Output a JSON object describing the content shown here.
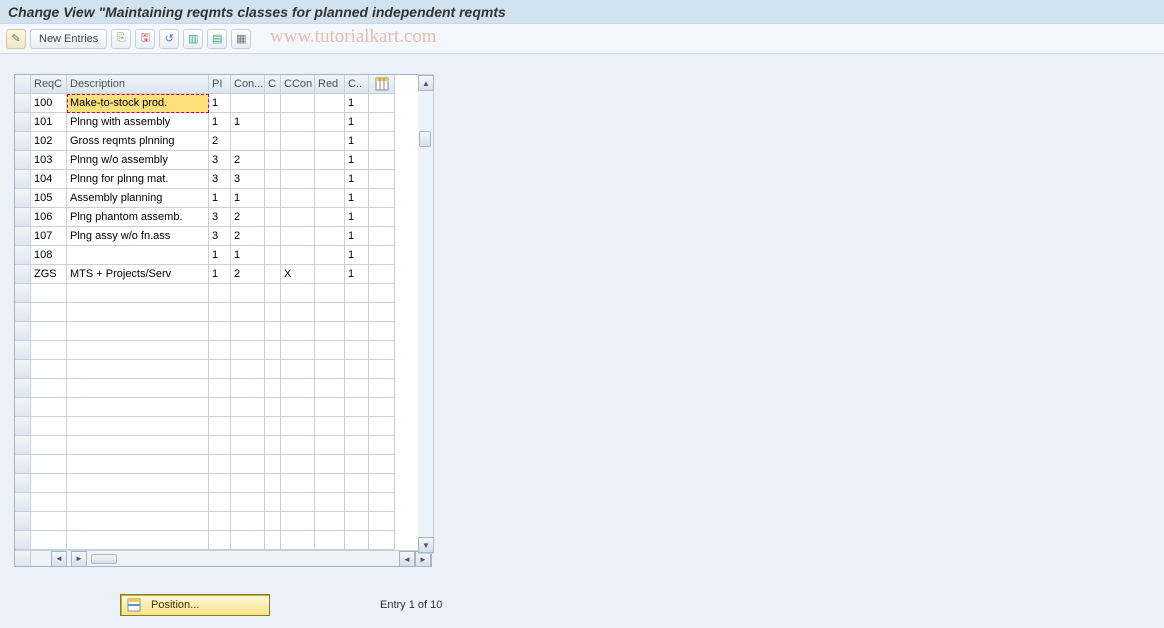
{
  "title": "Change View \"Maintaining reqmts classes for planned independent reqmts",
  "watermark": "www.tutorialkart.com",
  "toolbar": {
    "new_entries": "New Entries"
  },
  "columns": {
    "reqc": "ReqC",
    "desc": "Description",
    "pi": "PI",
    "con": "Con...",
    "cx": "C",
    "ccon": "CCon",
    "red": "Red",
    "cdot": "C.."
  },
  "rows": [
    {
      "reqc": "100",
      "desc": "Make-to-stock prod.",
      "pi": "1",
      "con": "",
      "cx": "",
      "ccon": "",
      "red": "",
      "cdot": "1",
      "editing": true
    },
    {
      "reqc": "101",
      "desc": "Plnng with assembly",
      "pi": "1",
      "con": "1",
      "cx": "",
      "ccon": "",
      "red": "",
      "cdot": "1"
    },
    {
      "reqc": "102",
      "desc": "Gross reqmts plnning",
      "pi": "2",
      "con": "",
      "cx": "",
      "ccon": "",
      "red": "",
      "cdot": "1"
    },
    {
      "reqc": "103",
      "desc": "Plnng w/o assembly",
      "pi": "3",
      "con": "2",
      "cx": "",
      "ccon": "",
      "red": "",
      "cdot": "1"
    },
    {
      "reqc": "104",
      "desc": "Plnng for plnng mat.",
      "pi": "3",
      "con": "3",
      "cx": "",
      "ccon": "",
      "red": "",
      "cdot": "1"
    },
    {
      "reqc": "105",
      "desc": "Assembly planning",
      "pi": "1",
      "con": "1",
      "cx": "",
      "ccon": "",
      "red": "",
      "cdot": "1"
    },
    {
      "reqc": "106",
      "desc": "Plng phantom assemb.",
      "pi": "3",
      "con": "2",
      "cx": "",
      "ccon": "",
      "red": "",
      "cdot": "1"
    },
    {
      "reqc": "107",
      "desc": "Plng assy w/o fn.ass",
      "pi": "3",
      "con": "2",
      "cx": "",
      "ccon": "",
      "red": "",
      "cdot": "1"
    },
    {
      "reqc": "108",
      "desc": "",
      "pi": "1",
      "con": "1",
      "cx": "",
      "ccon": "",
      "red": "",
      "cdot": "1"
    },
    {
      "reqc": "ZGS",
      "desc": "MTS + Projects/Serv",
      "pi": "1",
      "con": "2",
      "cx": "",
      "ccon": "X",
      "red": "",
      "cdot": "1"
    }
  ],
  "empty_rows": 14,
  "footer": {
    "position_label": "Position...",
    "entry_text": "Entry 1 of 10"
  }
}
